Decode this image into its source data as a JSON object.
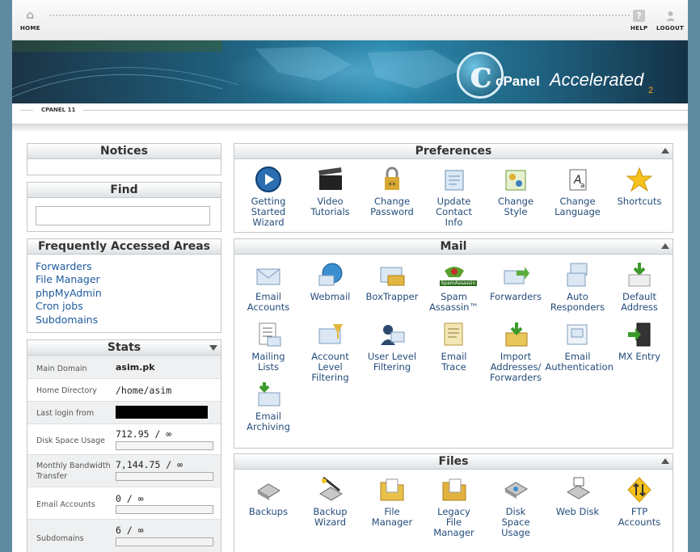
{
  "header": {
    "home": "HOME",
    "help": "HELP",
    "logout": "LOGOUT",
    "help_icon_glyph": "?"
  },
  "banner": {
    "logo_letter": "c",
    "logo_cpanel": "cPanel",
    "logo_accelerated": "Accelerated",
    "logo_version": "2"
  },
  "breadcrumb": {
    "label": "CPANEL 11"
  },
  "sidebar": {
    "notices_title": "Notices",
    "find_title": "Find",
    "find_value": "",
    "faa_title": "Frequently Accessed Areas",
    "faa_links": [
      "Forwarders",
      "File Manager",
      "phpMyAdmin",
      "Cron jobs",
      "Subdomains"
    ],
    "stats_title": "Stats",
    "stats": {
      "main_domain_label": "Main Domain",
      "main_domain_value": "asim.pk",
      "home_dir_label": "Home Directory",
      "home_dir_value": "/home/asim",
      "last_login_label": "Last login from",
      "disk_label": "Disk Space Usage",
      "disk_value": "712.95 / ∞",
      "disk_fraction": 0,
      "bw_label_1": "Monthly Bandwidth",
      "bw_label_2": "Transfer",
      "bw_value": "7,144.75 / ∞",
      "bw_fraction": 0,
      "email_label": "Email Accounts",
      "email_value": "0 / ∞",
      "email_fraction": 0,
      "sub_label": "Subdomains",
      "sub_value": "6 / ∞",
      "sub_fraction": 0
    }
  },
  "preferences": {
    "title": "Preferences",
    "items": [
      {
        "lines": [
          "Getting",
          "Started",
          "Wizard"
        ],
        "icon": "play-icon"
      },
      {
        "lines": [
          "Video",
          "Tutorials"
        ],
        "icon": "clapperboard-icon"
      },
      {
        "lines": [
          "Change",
          "Password"
        ],
        "icon": "lock-password-icon"
      },
      {
        "lines": [
          "Update",
          "Contact",
          "Info"
        ],
        "icon": "contact-card-icon"
      },
      {
        "lines": [
          "Change",
          "Style"
        ],
        "icon": "palette-icon"
      },
      {
        "lines": [
          "Change",
          "Language"
        ],
        "icon": "language-icon"
      },
      {
        "lines": [
          "Shortcuts"
        ],
        "icon": "star-icon"
      }
    ]
  },
  "mail": {
    "title": "Mail",
    "spam_logo": "SpamAssassin",
    "items": [
      {
        "lines": [
          "Email",
          "Accounts"
        ],
        "icon": "envelope-icon"
      },
      {
        "lines": [
          "Webmail"
        ],
        "icon": "globe-mail-icon"
      },
      {
        "lines": [
          "BoxTrapper"
        ],
        "icon": "boxtrapper-icon"
      },
      {
        "lines": [
          "Spam",
          "Assassin™"
        ],
        "icon": "spamassassin-icon"
      },
      {
        "lines": [
          "Forwarders"
        ],
        "icon": "forward-mail-icon"
      },
      {
        "lines": [
          "Auto",
          "Responders"
        ],
        "icon": "autoresponder-icon"
      },
      {
        "lines": [
          "Default",
          "Address"
        ],
        "icon": "default-address-icon"
      },
      {
        "lines": [
          "Mailing",
          "Lists"
        ],
        "icon": "mailing-list-icon"
      },
      {
        "lines": [
          "Account",
          "Level",
          "Filtering"
        ],
        "icon": "filter-icon"
      },
      {
        "lines": [
          "User Level",
          "Filtering"
        ],
        "icon": "user-filter-icon"
      },
      {
        "lines": [
          "Email",
          "Trace"
        ],
        "icon": "trace-icon"
      },
      {
        "lines": [
          "Import",
          "Addresses/",
          "Forwarders"
        ],
        "icon": "import-icon"
      },
      {
        "lines": [
          "Email",
          "Authentication"
        ],
        "icon": "auth-icon"
      },
      {
        "lines": [
          "MX Entry"
        ],
        "icon": "mx-server-icon"
      },
      {
        "lines": [
          "Email",
          "Archiving"
        ],
        "icon": "archive-icon"
      }
    ]
  },
  "files": {
    "title": "Files",
    "items": [
      {
        "lines": [
          "Backups"
        ],
        "icon": "disk-drive-icon"
      },
      {
        "lines": [
          "Backup",
          "Wizard"
        ],
        "icon": "backup-wizard-icon"
      },
      {
        "lines": [
          "File",
          "Manager"
        ],
        "icon": "folder-icon"
      },
      {
        "lines": [
          "Legacy",
          "File",
          "Manager"
        ],
        "icon": "legacy-folder-icon"
      },
      {
        "lines": [
          "Disk",
          "Space",
          "Usage"
        ],
        "icon": "disk-usage-icon"
      },
      {
        "lines": [
          "Web Disk"
        ],
        "icon": "web-disk-icon"
      },
      {
        "lines": [
          "FTP",
          "Accounts"
        ],
        "icon": "ftp-icon"
      }
    ]
  },
  "colors": {
    "link": "#1c5a9e",
    "label": "#244d7a",
    "bg": "#5f8aa0"
  }
}
